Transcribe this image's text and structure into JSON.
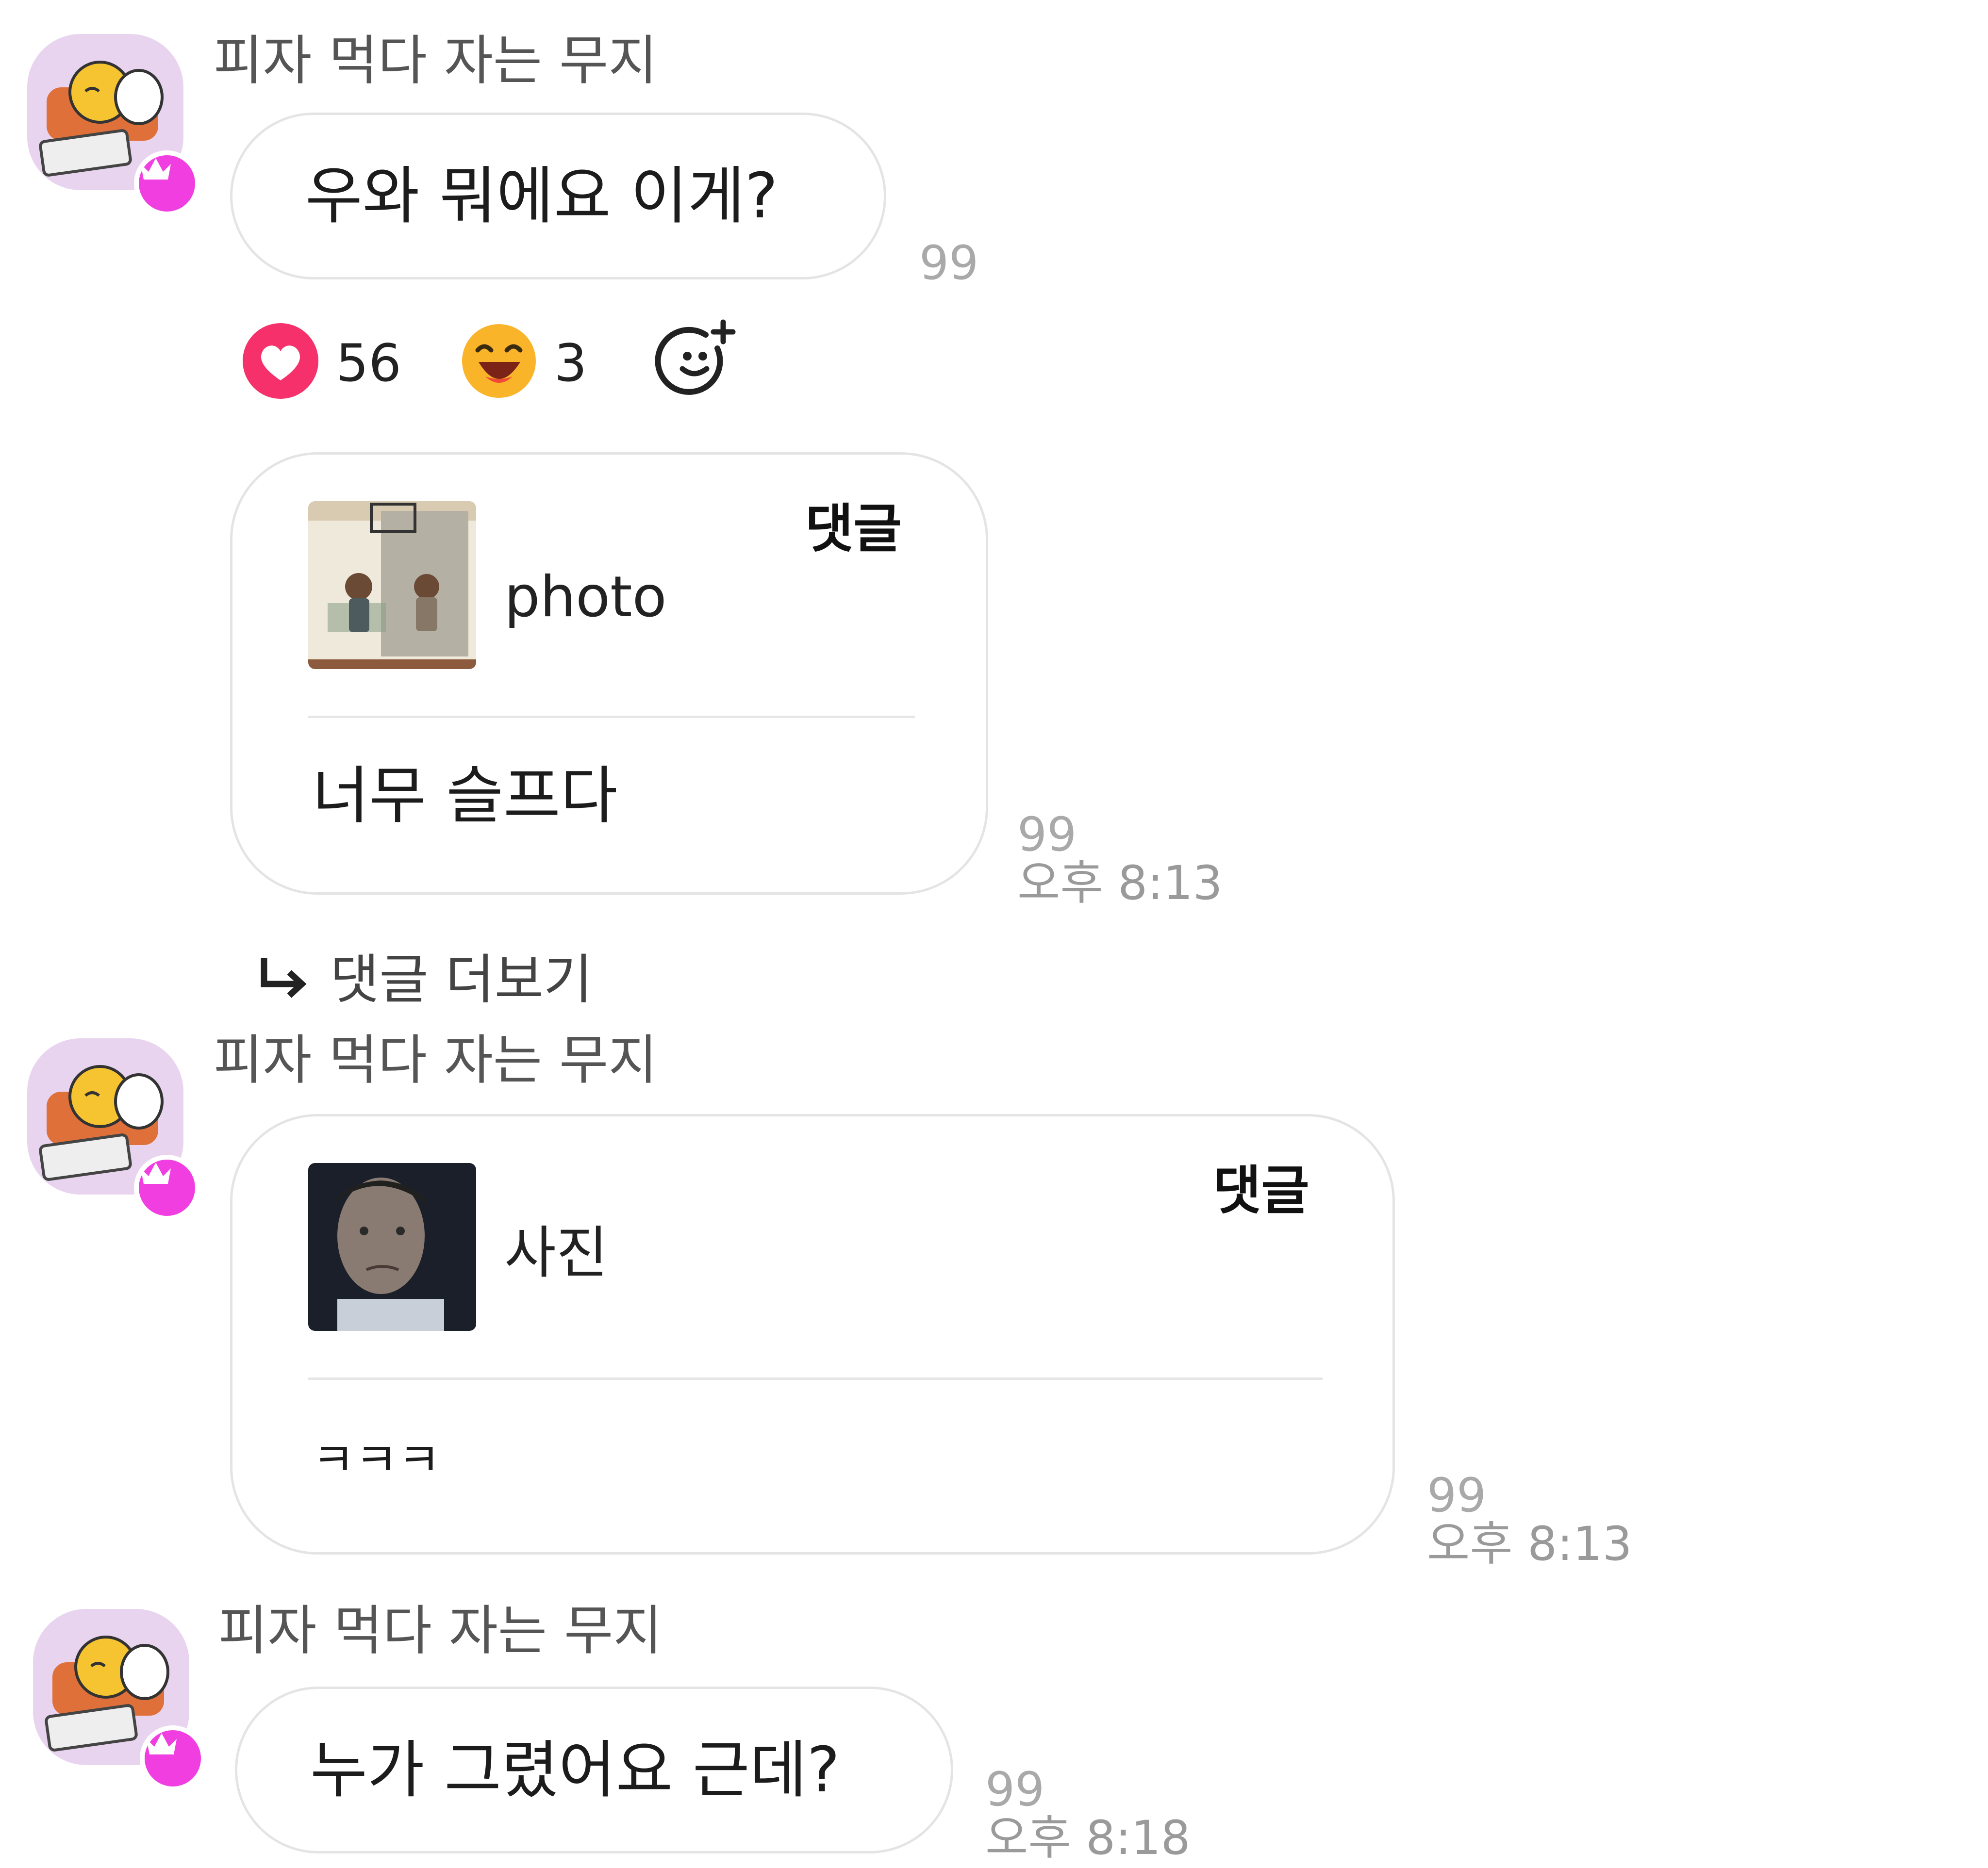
{
  "messages": [
    {
      "sender": "피자 먹다 자는 무지",
      "text": "우와 뭐에요 이게?",
      "unread": "99",
      "reactions": [
        {
          "icon": "heart-icon",
          "count": "56"
        },
        {
          "icon": "laughing-face-icon",
          "count": "3"
        }
      ]
    },
    {
      "reply_label": "댓글",
      "quoted_title": "photo",
      "text": "너무 슬프다",
      "unread": "99",
      "time": "오후 8:13"
    },
    {
      "more_replies": "댓글 더보기"
    },
    {
      "sender": "피자 먹다 자는 무지",
      "reply_label": "댓글",
      "quoted_title": "사진",
      "text": "ㅋㅋㅋ",
      "unread": "99",
      "time": "오후 8:13"
    },
    {
      "sender": "피자 먹다 자는 무지",
      "text": "누가 그렸어요 근데?",
      "unread": "99",
      "time": "오후 8:18"
    }
  ],
  "colors": {
    "heart": "#f5306b",
    "crown_badge": "#f03ee0",
    "avatar_bg": "#e9d4ef",
    "bubble_border": "#e4e4e4",
    "meta_gray": "#a9a9a9"
  }
}
